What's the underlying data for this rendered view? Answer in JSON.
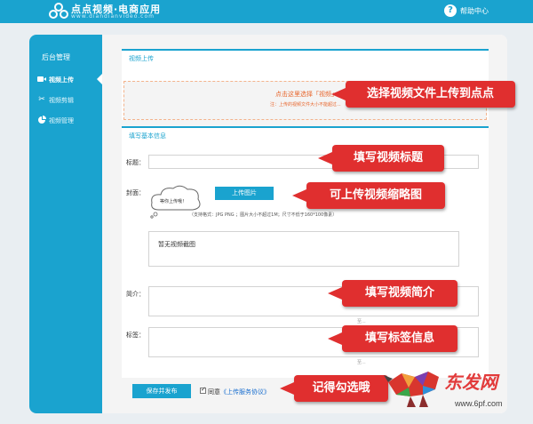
{
  "header": {
    "brand_title": "点点视频·电商应用",
    "brand_sub": "www.diandianvideo.com",
    "help_label": "帮助中心"
  },
  "sidebar": {
    "title": "后台管理",
    "items": [
      {
        "label": "视频上传",
        "icon": "video-camera-icon",
        "active": true
      },
      {
        "label": "视频剪辑",
        "icon": "scissors-icon",
        "active": false
      },
      {
        "label": "视频管理",
        "icon": "pie-chart-icon",
        "active": false
      }
    ]
  },
  "upload_section": {
    "title": "视频上传",
    "drop_text": "点击这里选择「视频」",
    "drop_note": "注：上传的视频文件大小不能超过..."
  },
  "info_section": {
    "title": "填写基本信息",
    "title_label": "标题：",
    "cover_label": "封面：",
    "cloud_text": "等你上传哦！",
    "upload_image_button": "上传图片",
    "cover_hint": "（支持格式：JPG PNG ；图片大小不超过1M；尺寸不低于160*100像素）",
    "no_thumb_text": "暂无视频截图",
    "intro_label": "简介：",
    "intro_counter": "至...",
    "tags_label": "标签：",
    "tags_counter": "至...",
    "save_button": "保存并发布",
    "agree_prefix": "同意",
    "agree_link": "《上传服务协议》",
    "agree_checked": true
  },
  "callouts": [
    "选择视频文件上传到点点",
    "填写视频标题",
    "可上传视频缩略图",
    "填写视频简介",
    "填写标签信息",
    "记得勾选哦"
  ],
  "watermark": {
    "text": "东发网",
    "url": "www.6pf.com"
  },
  "colors": {
    "accent": "#1aa3cf",
    "callout": "#e02f2f",
    "drop_text": "#e8672e"
  }
}
